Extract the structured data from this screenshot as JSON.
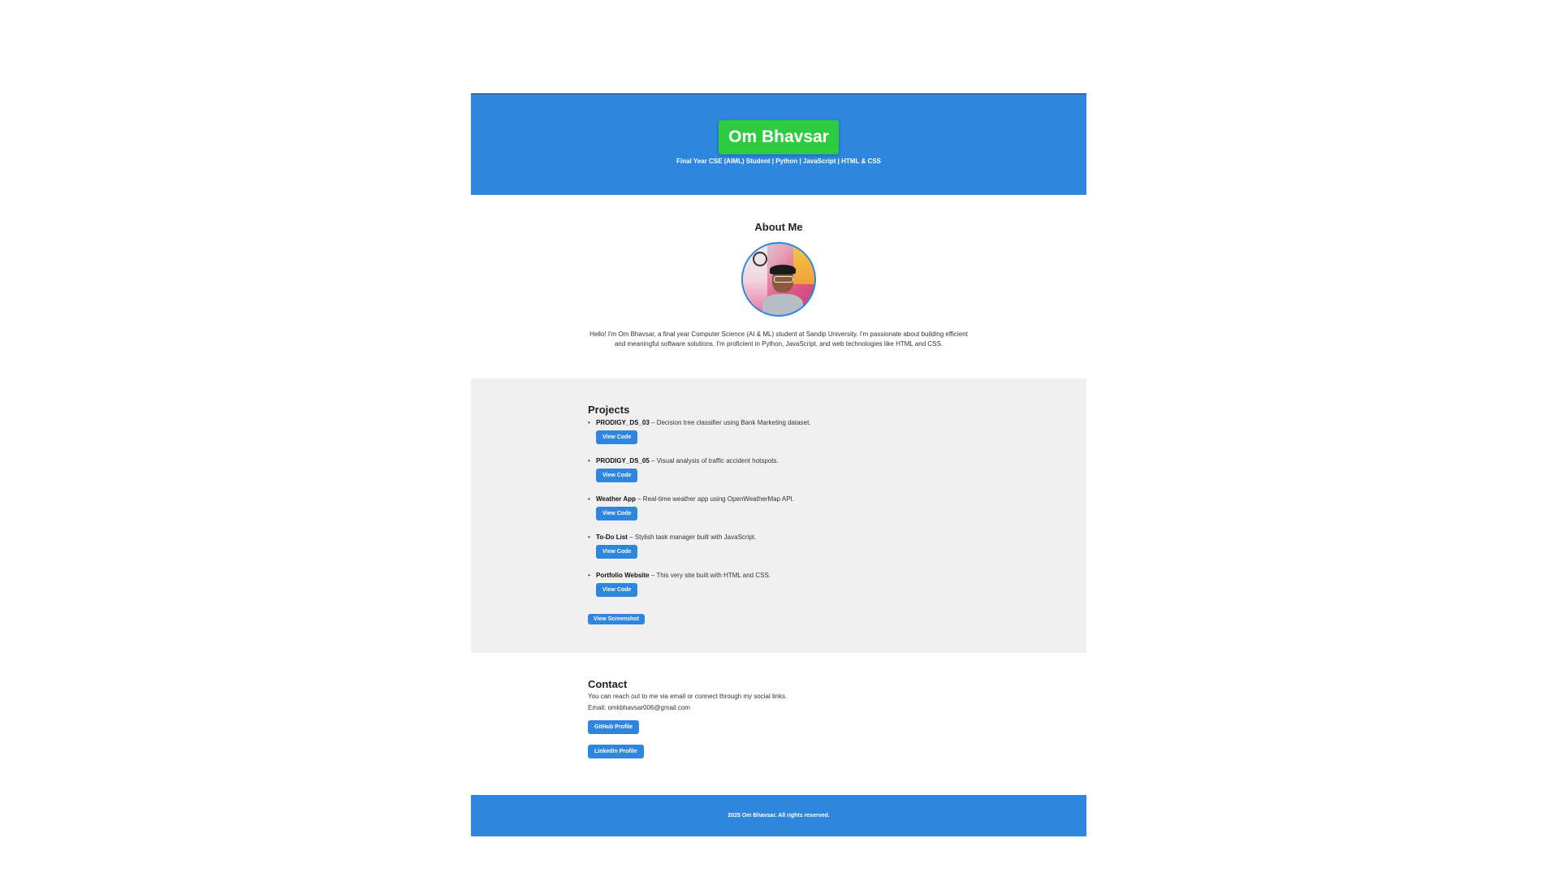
{
  "header": {
    "name": "Om Bhavsar",
    "tagline": "Final Year CSE (AIML) Student | Python | JavaScript | HTML & CSS"
  },
  "about": {
    "title": "About Me",
    "text": "Hello! I'm Om Bhavsar, a final year Computer Science (AI & ML) student at Sandip University. I'm passionate about building efficient and meaningful software solutions. I'm proficient in Python, JavaScript, and web technologies like HTML and CSS."
  },
  "projects": {
    "title": "Projects",
    "items": [
      {
        "name": "PRODIGY_DS_03",
        "desc": " – Decision tree classifier using Bank Marketing dataset.",
        "button": "View Code"
      },
      {
        "name": "PRODIGY_DS_05",
        "desc": " – Visual analysis of traffic accident hotspots.",
        "button": "View Code"
      },
      {
        "name": "Weather App",
        "desc": " – Real-time weather app using OpenWeatherMap API.",
        "button": "View Code"
      },
      {
        "name": "To-Do List",
        "desc": " – Stylish task manager built with JavaScript.",
        "button": "View Code"
      },
      {
        "name": "Portfolio Website",
        "desc": " – This very site built with HTML and CSS.",
        "button": "View Code"
      }
    ],
    "screenshot_button": "View Screenshot"
  },
  "contact": {
    "title": "Contact",
    "text": "You can reach out to me via email or connect through my social links.",
    "email": "Email: omkbhavsar006@gmail.com",
    "github_button": "GitHub Profile",
    "linkedin_button": "LinkedIn Profile"
  },
  "footer": {
    "text": "2025 Om Bhavsar. All rights reserved."
  },
  "colors": {
    "primary": "#2e86de",
    "name_badge": "#2ecc40",
    "section_bg": "#f0f0f0"
  }
}
